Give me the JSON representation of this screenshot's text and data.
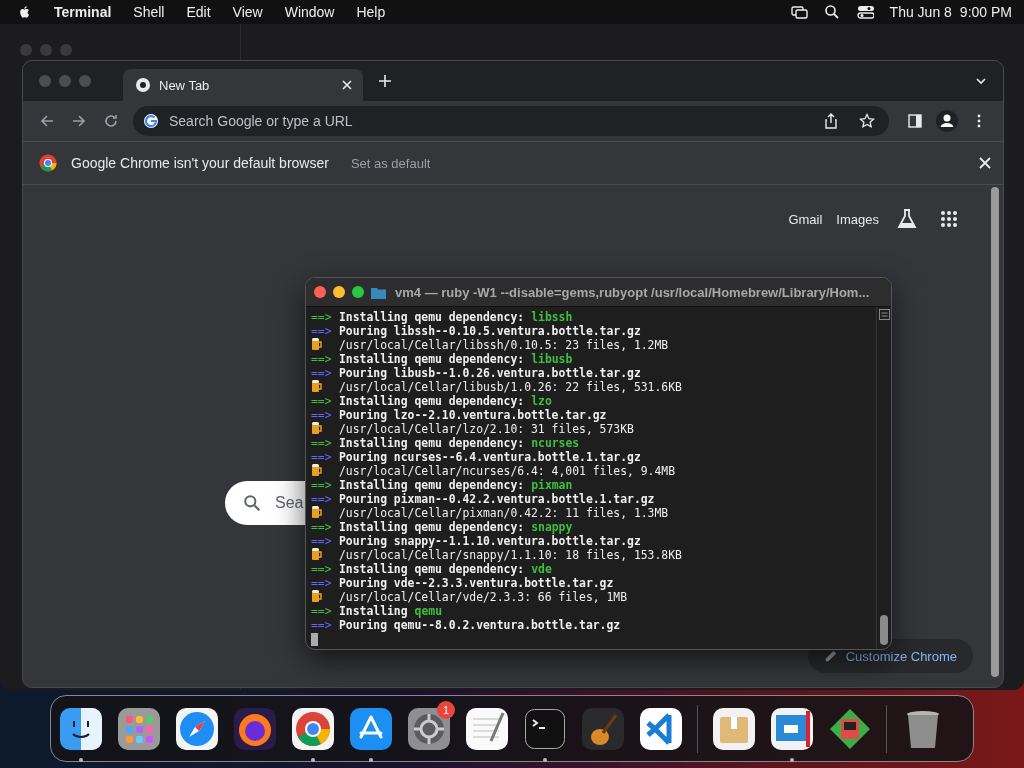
{
  "menu_bar": {
    "app": "Terminal",
    "items": [
      "Shell",
      "Edit",
      "View",
      "Window",
      "Help"
    ],
    "date": "Thu Jun 8",
    "time": "9:00 PM"
  },
  "browser": {
    "tab": {
      "title": "New Tab",
      "selected": true
    },
    "omnibox": {
      "placeholder": "Search Google or type a URL"
    },
    "infobar": {
      "message": "Google Chrome isn't your default browser",
      "action": "Set as default"
    },
    "links": [
      "Gmail",
      "Images"
    ],
    "search": {
      "placeholder": "Sea"
    },
    "customize": "Customize Chrome"
  },
  "terminal": {
    "title": "vm4 — ruby -W1 --disable=gems,rubyopt /usr/local/Homebrew/Library/Hom...",
    "lines": [
      {
        "kind": "install",
        "marker": "==>",
        "text": "Installing qemu dependency:",
        "package": "libssh"
      },
      {
        "kind": "pour",
        "marker": "==>",
        "text": "Pouring libssh--0.10.5.ventura.bottle.tar.gz"
      },
      {
        "kind": "done",
        "text": "/usr/local/Cellar/libssh/0.10.5: 23 files, 1.2MB"
      },
      {
        "kind": "install",
        "marker": "==>",
        "text": "Installing qemu dependency:",
        "package": "libusb"
      },
      {
        "kind": "pour",
        "marker": "==>",
        "text": "Pouring libusb--1.0.26.ventura.bottle.tar.gz"
      },
      {
        "kind": "done",
        "text": "/usr/local/Cellar/libusb/1.0.26: 22 files, 531.6KB"
      },
      {
        "kind": "install",
        "marker": "==>",
        "text": "Installing qemu dependency:",
        "package": "lzo"
      },
      {
        "kind": "pour",
        "marker": "==>",
        "text": "Pouring lzo--2.10.ventura.bottle.tar.gz"
      },
      {
        "kind": "done",
        "text": "/usr/local/Cellar/lzo/2.10: 31 files, 573KB"
      },
      {
        "kind": "install",
        "marker": "==>",
        "text": "Installing qemu dependency:",
        "package": "ncurses"
      },
      {
        "kind": "pour",
        "marker": "==>",
        "text": "Pouring ncurses--6.4.ventura.bottle.1.tar.gz"
      },
      {
        "kind": "done",
        "text": "/usr/local/Cellar/ncurses/6.4: 4,001 files, 9.4MB"
      },
      {
        "kind": "install",
        "marker": "==>",
        "text": "Installing qemu dependency:",
        "package": "pixman"
      },
      {
        "kind": "pour",
        "marker": "==>",
        "text": "Pouring pixman--0.42.2.ventura.bottle.1.tar.gz"
      },
      {
        "kind": "done",
        "text": "/usr/local/Cellar/pixman/0.42.2: 11 files, 1.3MB"
      },
      {
        "kind": "install",
        "marker": "==>",
        "text": "Installing qemu dependency:",
        "package": "snappy"
      },
      {
        "kind": "pour",
        "marker": "==>",
        "text": "Pouring snappy--1.1.10.ventura.bottle.tar.gz"
      },
      {
        "kind": "done",
        "text": "/usr/local/Cellar/snappy/1.1.10: 18 files, 153.8KB"
      },
      {
        "kind": "install",
        "marker": "==>",
        "text": "Installing qemu dependency:",
        "package": "vde"
      },
      {
        "kind": "pour",
        "marker": "==>",
        "text": "Pouring vde--2.3.3.ventura.bottle.tar.gz"
      },
      {
        "kind": "done",
        "text": "/usr/local/Cellar/vde/2.3.3: 66 files, 1MB"
      },
      {
        "kind": "install",
        "marker": "==>",
        "text": "Installing",
        "package": "qemu"
      },
      {
        "kind": "pour",
        "marker": "==>",
        "text": "Pouring qemu--8.0.2.ventura.bottle.tar.gz"
      }
    ]
  },
  "dock": {
    "apps": [
      {
        "running": true
      },
      {
        "running": false
      },
      {
        "running": false
      },
      {
        "running": false
      },
      {
        "running": true
      },
      {
        "running": true
      },
      {
        "running": false,
        "badge": "1"
      },
      {
        "running": false
      },
      {
        "running": true
      },
      {
        "running": false
      },
      {
        "running": false
      }
    ],
    "documents": [
      {
        "running": false
      },
      {
        "running": true
      },
      {
        "running": false
      }
    ]
  }
}
